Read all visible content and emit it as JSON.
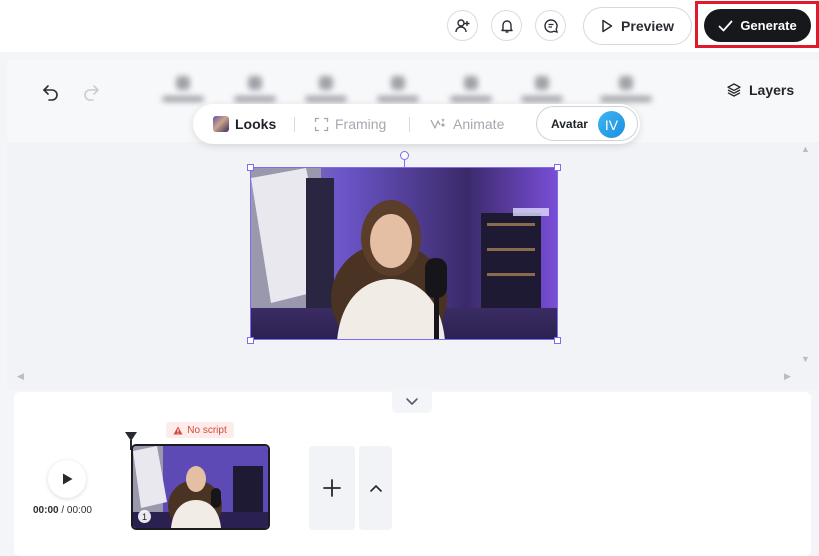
{
  "header": {
    "preview_label": "Preview",
    "generate_label": "Generate",
    "icons": [
      "add-person-icon",
      "bell-icon",
      "comment-icon"
    ]
  },
  "editor": {
    "layers_label": "Layers",
    "looks_label": "Looks",
    "framing_label": "Framing",
    "animate_label": "Animate",
    "avatar_label": "Avatar",
    "avatar_initials": "IV"
  },
  "timeline": {
    "current_time": "00:00",
    "total_time": "00:00",
    "time_separator": " / ",
    "no_script_label": "No script",
    "scene_number": "1"
  },
  "colors": {
    "accent_selection": "#7b6cf0",
    "generate_bg": "#17181c",
    "highlight_border": "#e0192b",
    "warning_text": "#d24a3e",
    "avatar_bg": "#1a8fe0"
  }
}
